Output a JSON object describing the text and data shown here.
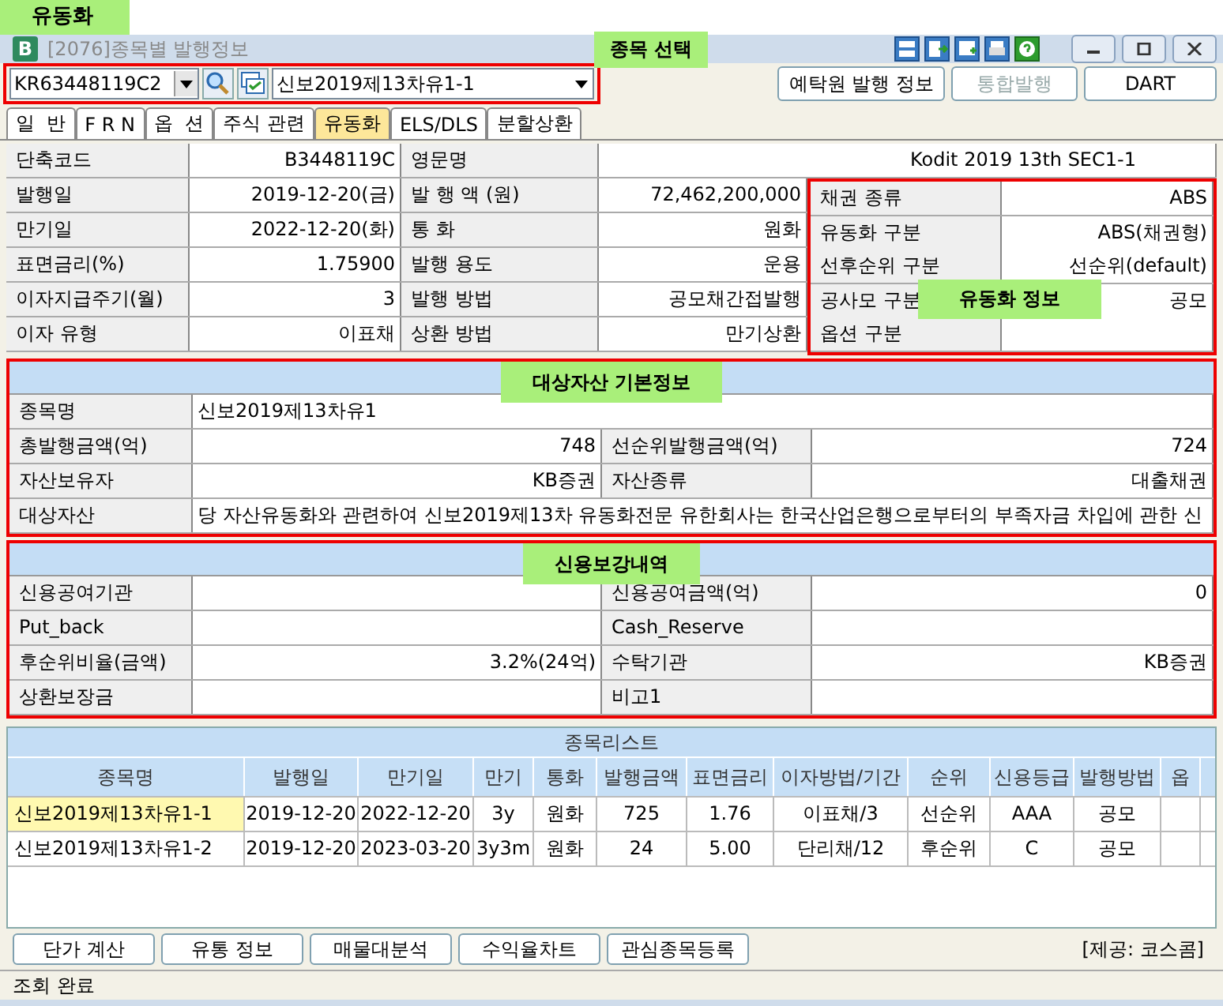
{
  "page_label": "유동화",
  "window": {
    "badge": "B",
    "title": "[2076]종목별 발행정보"
  },
  "security_select": {
    "annotation": "종목 선택",
    "code": "KR63448119C2",
    "name": "신보2019제13차유1-1"
  },
  "action_buttons": [
    {
      "label": "예탁원 발행 정보",
      "disabled": false
    },
    {
      "label": "통합발행",
      "disabled": true
    },
    {
      "label": "DART",
      "disabled": false
    }
  ],
  "tabs": [
    {
      "label": "일  반",
      "selected": false
    },
    {
      "label": "F R N",
      "selected": false
    },
    {
      "label": "옵  션",
      "selected": false
    },
    {
      "label": "주식 관련",
      "selected": false
    },
    {
      "label": "유동화",
      "selected": true
    },
    {
      "label": "ELS/DLS",
      "selected": false
    },
    {
      "label": "분할상환",
      "selected": false
    }
  ],
  "basic_info": {
    "top_row": [
      {
        "label": "단축코드",
        "value": "B3448119C"
      },
      {
        "label": "영문명",
        "value": "Kodit 2019 13th SEC1-1"
      }
    ],
    "rows": [
      [
        {
          "label": "발행일",
          "value": "2019-12-20(금)"
        },
        {
          "label": "발 행 액 (원)",
          "value": "72,462,200,000"
        }
      ],
      [
        {
          "label": "만기일",
          "value": "2022-12-20(화)"
        },
        {
          "label": "통  화",
          "value": "원화"
        }
      ],
      [
        {
          "label": "표면금리(%)",
          "value": "1.75900"
        },
        {
          "label": "발행 용도",
          "value": "운용"
        }
      ],
      [
        {
          "label": "이자지급주기(월)",
          "value": "3"
        },
        {
          "label": "발행 방법",
          "value": "공모채간접발행"
        }
      ],
      [
        {
          "label": "이자 유형",
          "value": "이표채"
        },
        {
          "label": "상환 방법",
          "value": "만기상환"
        }
      ]
    ]
  },
  "securitization_info": {
    "annotation": "유동화 정보",
    "rows": [
      {
        "label": "채권 종류",
        "value": "ABS"
      },
      {
        "label": "유동화 구분",
        "value": "ABS(채권형)"
      },
      {
        "label": "선후순위 구분",
        "value": "선순위(default)"
      },
      {
        "label": "공사모 구분",
        "value": "공모"
      },
      {
        "label": "옵션 구분"
      }
    ]
  },
  "underlying_asset": {
    "title": "대상자산 기본정보",
    "rows": [
      [
        {
          "label": "종목명",
          "value": "신보2019제13차유1"
        }
      ],
      [
        {
          "label": "총발행금액(억)",
          "value": "748"
        },
        {
          "label": "선순위발행금액(억)",
          "value": "724"
        }
      ],
      [
        {
          "label": "자산보유자",
          "value": "KB증권"
        },
        {
          "label": "자산종류",
          "value": "대출채권"
        }
      ],
      [
        {
          "label": "대상자산",
          "value": "당 자산유동화와 관련하여 신보2019제13차 유동화전문 유한회사는 한국산업은행으로부터의 부족자금 차입에 관한 신"
        }
      ]
    ]
  },
  "credit_enhancement": {
    "title": "신용보강내역",
    "rows": [
      [
        {
          "label": "신용공여기관"
        },
        {
          "label": "신용공여금액(억)",
          "value": "0"
        }
      ],
      [
        {
          "label": "Put_back"
        },
        {
          "label": "Cash_Reserve"
        }
      ],
      [
        {
          "label": "후순위비율(금액)",
          "value": "3.2%(24억)"
        },
        {
          "label": "수탁기관",
          "value": "KB증권"
        }
      ],
      [
        {
          "label": "상환보장금"
        },
        {
          "label": "비고1"
        }
      ]
    ]
  },
  "security_list": {
    "title": "종목리스트",
    "columns": [
      "종목명",
      "발행일",
      "만기일",
      "만기",
      "통화",
      "발행금액",
      "표면금리",
      "이자방법/기간",
      "순위",
      "신용등급",
      "발행방법",
      "옵"
    ],
    "rows": [
      {
        "selected": true,
        "cells": [
          "신보2019제13차유1-1",
          "2019-12-20",
          "2022-12-20",
          "3y",
          "원화",
          "725",
          "1.76",
          "이표채/3",
          "선순위",
          "AAA",
          "공모"
        ]
      },
      {
        "selected": false,
        "cells": [
          "신보2019제13차유1-2",
          "2019-12-20",
          "2023-03-20",
          "3y3m",
          "원화",
          "24",
          "5.00",
          "단리채/12",
          "후순위",
          "C",
          "공모"
        ]
      }
    ]
  },
  "bottom_buttons": [
    "단가 계산",
    "유통 정보",
    "매물대분석",
    "수익율차트",
    "관심종목등록"
  ],
  "provider": "[제공: 코스콤]",
  "status_bar": "조회 완료"
}
